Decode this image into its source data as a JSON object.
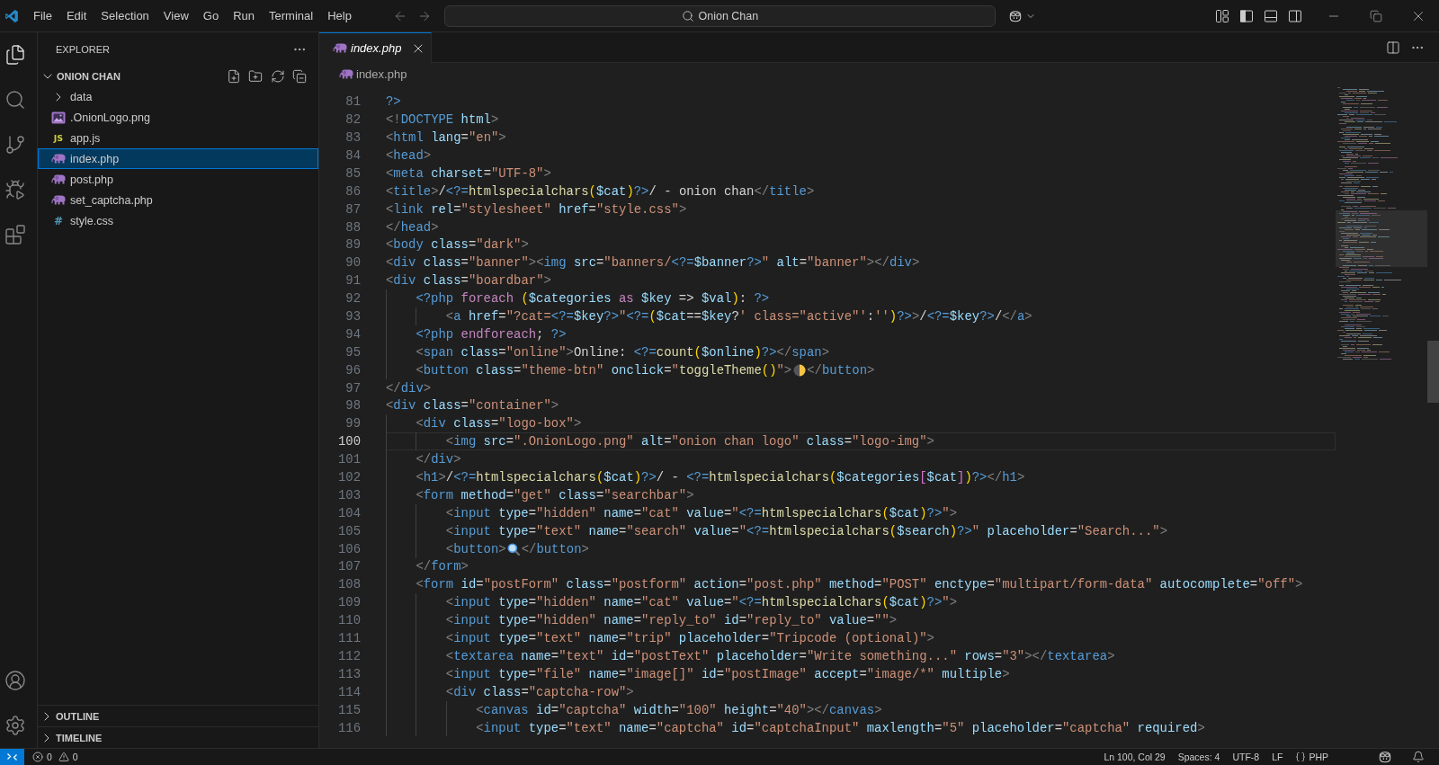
{
  "title_bar": {
    "menus": [
      "File",
      "Edit",
      "Selection",
      "View",
      "Go",
      "Run",
      "Terminal",
      "Help"
    ],
    "command_center": "Onion Chan",
    "layout_toggles": [
      {
        "kind": "primary_sidebar",
        "on": true
      },
      {
        "kind": "panel",
        "on": false
      },
      {
        "kind": "secondary_sidebar",
        "on": false
      }
    ]
  },
  "activity_bar": {
    "top": [
      {
        "kind": "explorer",
        "selected": true
      },
      {
        "kind": "search",
        "selected": false
      },
      {
        "kind": "source_control",
        "selected": false
      },
      {
        "kind": "run_debug",
        "selected": false
      },
      {
        "kind": "extensions",
        "selected": false
      }
    ],
    "bottom": [
      {
        "kind": "accounts"
      },
      {
        "kind": "settings"
      }
    ]
  },
  "sidebar": {
    "title": "EXPLORER",
    "root": {
      "label": "ONION CHAN",
      "expanded": true,
      "children": [
        {
          "kind": "folder",
          "label": "data",
          "expanded": false,
          "selected": false
        },
        {
          "kind": "image",
          "label": ".OnionLogo.png",
          "selected": false
        },
        {
          "kind": "js",
          "glyph": "JS",
          "label": "app.js",
          "selected": false
        },
        {
          "kind": "php",
          "label": "index.php",
          "selected": true
        },
        {
          "kind": "php",
          "label": "post.php",
          "selected": false
        },
        {
          "kind": "php",
          "label": "set_captcha.php",
          "selected": false
        },
        {
          "kind": "css",
          "glyph": "#",
          "label": "style.css",
          "selected": false
        }
      ]
    },
    "sections": [
      {
        "label": "OUTLINE",
        "expanded": false
      },
      {
        "label": "TIMELINE",
        "expanded": false
      }
    ]
  },
  "editor": {
    "tabs": [
      {
        "kind": "php",
        "label": "index.php",
        "selected": true,
        "preview": true
      }
    ],
    "breadcrumbs": [
      {
        "kind": "php",
        "label": "index.php"
      }
    ],
    "lines": [
      {
        "number": "81",
        "current": false,
        "tokens": [
          {
            "kind": "php",
            "text": "?>"
          }
        ]
      },
      {
        "number": "82",
        "current": false,
        "tokens": [
          {
            "kind": "punct",
            "text": "<!"
          },
          {
            "kind": "tag",
            "text": "DOCTYPE"
          },
          {
            "kind": "attr",
            "text": " html"
          },
          {
            "kind": "punct",
            "text": ">"
          }
        ]
      },
      {
        "number": "83",
        "current": false,
        "tokens": [
          {
            "kind": "punct",
            "text": "<"
          },
          {
            "kind": "tag",
            "text": "html"
          },
          {
            "kind": "attr",
            "text": " lang"
          },
          {
            "kind": "plain",
            "text": "="
          },
          {
            "kind": "string",
            "text": "\"en\""
          },
          {
            "kind": "punct",
            "text": ">"
          }
        ]
      },
      {
        "number": "84",
        "current": false,
        "tokens": [
          {
            "kind": "punct",
            "text": "<"
          },
          {
            "kind": "tag",
            "text": "head"
          },
          {
            "kind": "punct",
            "text": ">"
          }
        ]
      },
      {
        "number": "85",
        "current": false,
        "tokens": [
          {
            "kind": "punct",
            "text": "<"
          },
          {
            "kind": "tag",
            "text": "meta"
          },
          {
            "kind": "attr",
            "text": " charset"
          },
          {
            "kind": "plain",
            "text": "="
          },
          {
            "kind": "string",
            "text": "\"UTF-8\""
          },
          {
            "kind": "punct",
            "text": ">"
          }
        ]
      },
      {
        "number": "86",
        "current": false,
        "tokens": [
          {
            "kind": "punct",
            "text": "<"
          },
          {
            "kind": "tag",
            "text": "title"
          },
          {
            "kind": "punct",
            "text": ">"
          },
          {
            "kind": "plain",
            "text": "/"
          },
          {
            "kind": "php",
            "text": "<?="
          },
          {
            "kind": "function",
            "text": "htmlspecialchars"
          },
          {
            "kind": "paren",
            "text": "("
          },
          {
            "kind": "variable",
            "text": "$cat"
          },
          {
            "kind": "paren",
            "text": ")"
          },
          {
            "kind": "php",
            "text": "?>"
          },
          {
            "kind": "plain",
            "text": "/ - onion chan"
          },
          {
            "kind": "punct",
            "text": "</"
          },
          {
            "kind": "tag",
            "text": "title"
          },
          {
            "kind": "punct",
            "text": ">"
          }
        ]
      },
      {
        "number": "87",
        "current": false,
        "tokens": [
          {
            "kind": "punct",
            "text": "<"
          },
          {
            "kind": "tag",
            "text": "link"
          },
          {
            "kind": "attr",
            "text": " rel"
          },
          {
            "kind": "plain",
            "text": "="
          },
          {
            "kind": "string",
            "text": "\"stylesheet\""
          },
          {
            "kind": "attr",
            "text": " href"
          },
          {
            "kind": "plain",
            "text": "="
          },
          {
            "kind": "string",
            "text": "\"style.css\""
          },
          {
            "kind": "punct",
            "text": ">"
          }
        ]
      },
      {
        "number": "88",
        "current": false,
        "tokens": [
          {
            "kind": "punct",
            "text": "</"
          },
          {
            "kind": "tag",
            "text": "head"
          },
          {
            "kind": "punct",
            "text": ">"
          }
        ]
      },
      {
        "number": "89",
        "current": false,
        "tokens": [
          {
            "kind": "punct",
            "text": "<"
          },
          {
            "kind": "tag",
            "text": "body"
          },
          {
            "kind": "attr",
            "text": " class"
          },
          {
            "kind": "plain",
            "text": "="
          },
          {
            "kind": "string",
            "text": "\"dark\""
          },
          {
            "kind": "punct",
            "text": ">"
          }
        ]
      },
      {
        "number": "90",
        "current": false,
        "tokens": [
          {
            "kind": "punct",
            "text": "<"
          },
          {
            "kind": "tag",
            "text": "div"
          },
          {
            "kind": "attr",
            "text": " class"
          },
          {
            "kind": "plain",
            "text": "="
          },
          {
            "kind": "string",
            "text": "\"banner\""
          },
          {
            "kind": "punct",
            "text": "><"
          },
          {
            "kind": "tag",
            "text": "img"
          },
          {
            "kind": "attr",
            "text": " src"
          },
          {
            "kind": "plain",
            "text": "="
          },
          {
            "kind": "string",
            "text": "\"banners/"
          },
          {
            "kind": "php",
            "text": "<?="
          },
          {
            "kind": "variable",
            "text": "$banner"
          },
          {
            "kind": "php",
            "text": "?>"
          },
          {
            "kind": "string",
            "text": "\""
          },
          {
            "kind": "attr",
            "text": " alt"
          },
          {
            "kind": "plain",
            "text": "="
          },
          {
            "kind": "string",
            "text": "\"banner\""
          },
          {
            "kind": "punct",
            "text": "></"
          },
          {
            "kind": "tag",
            "text": "div"
          },
          {
            "kind": "punct",
            "text": ">"
          }
        ]
      },
      {
        "number": "91",
        "current": false,
        "tokens": [
          {
            "kind": "punct",
            "text": "<"
          },
          {
            "kind": "tag",
            "text": "div"
          },
          {
            "kind": "attr",
            "text": " class"
          },
          {
            "kind": "plain",
            "text": "="
          },
          {
            "kind": "string",
            "text": "\"boardbar\""
          },
          {
            "kind": "punct",
            "text": ">"
          }
        ]
      },
      {
        "number": "92",
        "current": false,
        "tokens": [
          {
            "kind": "php",
            "text": "    <?php"
          },
          {
            "kind": "keyword",
            "text": " foreach"
          },
          {
            "kind": "paren",
            "text": " ("
          },
          {
            "kind": "variable",
            "text": "$categories"
          },
          {
            "kind": "keyword",
            "text": " as"
          },
          {
            "kind": "variable",
            "text": " $key"
          },
          {
            "kind": "plain",
            "text": " =>"
          },
          {
            "kind": "variable",
            "text": " $val"
          },
          {
            "kind": "paren",
            "text": ")"
          },
          {
            "kind": "plain",
            "text": ":"
          },
          {
            "kind": "php",
            "text": " ?>"
          }
        ]
      },
      {
        "number": "93",
        "current": false,
        "tokens": [
          {
            "kind": "punct",
            "text": "        <"
          },
          {
            "kind": "tag",
            "text": "a"
          },
          {
            "kind": "attr",
            "text": " href"
          },
          {
            "kind": "plain",
            "text": "="
          },
          {
            "kind": "string",
            "text": "\"?cat="
          },
          {
            "kind": "php",
            "text": "<?="
          },
          {
            "kind": "variable",
            "text": "$key"
          },
          {
            "kind": "php",
            "text": "?>"
          },
          {
            "kind": "string",
            "text": "\""
          },
          {
            "kind": "php",
            "text": "<?="
          },
          {
            "kind": "paren",
            "text": "("
          },
          {
            "kind": "variable",
            "text": "$cat"
          },
          {
            "kind": "plain",
            "text": "=="
          },
          {
            "kind": "variable",
            "text": "$key"
          },
          {
            "kind": "plain",
            "text": "?"
          },
          {
            "kind": "string",
            "text": "' class=\"active\"'"
          },
          {
            "kind": "plain",
            "text": ":"
          },
          {
            "kind": "string",
            "text": "''"
          },
          {
            "kind": "paren",
            "text": ")"
          },
          {
            "kind": "php",
            "text": "?>"
          },
          {
            "kind": "punct",
            "text": ">"
          },
          {
            "kind": "plain",
            "text": "/"
          },
          {
            "kind": "php",
            "text": "<?="
          },
          {
            "kind": "variable",
            "text": "$key"
          },
          {
            "kind": "php",
            "text": "?>"
          },
          {
            "kind": "plain",
            "text": "/"
          },
          {
            "kind": "punct",
            "text": "</"
          },
          {
            "kind": "tag",
            "text": "a"
          },
          {
            "kind": "punct",
            "text": ">"
          }
        ]
      },
      {
        "number": "94",
        "current": false,
        "tokens": [
          {
            "kind": "php",
            "text": "    <?php"
          },
          {
            "kind": "keyword",
            "text": " endforeach"
          },
          {
            "kind": "plain",
            "text": ";"
          },
          {
            "kind": "php",
            "text": " ?>"
          }
        ]
      },
      {
        "number": "95",
        "current": false,
        "tokens": [
          {
            "kind": "punct",
            "text": "    <"
          },
          {
            "kind": "tag",
            "text": "span"
          },
          {
            "kind": "attr",
            "text": " class"
          },
          {
            "kind": "plain",
            "text": "="
          },
          {
            "kind": "string",
            "text": "\"online\""
          },
          {
            "kind": "punct",
            "text": ">"
          },
          {
            "kind": "plain",
            "text": "Online: "
          },
          {
            "kind": "php",
            "text": "<?="
          },
          {
            "kind": "function",
            "text": "count"
          },
          {
            "kind": "paren",
            "text": "("
          },
          {
            "kind": "variable",
            "text": "$online"
          },
          {
            "kind": "paren",
            "text": ")"
          },
          {
            "kind": "php",
            "text": "?>"
          },
          {
            "kind": "punct",
            "text": "</"
          },
          {
            "kind": "tag",
            "text": "span"
          },
          {
            "kind": "punct",
            "text": ">"
          }
        ]
      },
      {
        "number": "96",
        "current": false,
        "tokens": [
          {
            "kind": "punct",
            "text": "    <"
          },
          {
            "kind": "tag",
            "text": "button"
          },
          {
            "kind": "attr",
            "text": " class"
          },
          {
            "kind": "plain",
            "text": "="
          },
          {
            "kind": "string",
            "text": "\"theme-btn\""
          },
          {
            "kind": "attr",
            "text": " onclick"
          },
          {
            "kind": "plain",
            "text": "="
          },
          {
            "kind": "string",
            "text": "\""
          },
          {
            "kind": "function",
            "text": "toggleTheme"
          },
          {
            "kind": "paren",
            "text": "()"
          },
          {
            "kind": "string",
            "text": "\""
          },
          {
            "kind": "punct",
            "text": ">"
          },
          {
            "kind": "moon"
          },
          {
            "kind": "punct",
            "text": "</"
          },
          {
            "kind": "tag",
            "text": "button"
          },
          {
            "kind": "punct",
            "text": ">"
          }
        ]
      },
      {
        "number": "97",
        "current": false,
        "tokens": [
          {
            "kind": "punct",
            "text": "</"
          },
          {
            "kind": "tag",
            "text": "div"
          },
          {
            "kind": "punct",
            "text": ">"
          }
        ]
      },
      {
        "number": "98",
        "current": false,
        "tokens": [
          {
            "kind": "punct",
            "text": "<"
          },
          {
            "kind": "tag",
            "text": "div"
          },
          {
            "kind": "attr",
            "text": " class"
          },
          {
            "kind": "plain",
            "text": "="
          },
          {
            "kind": "string",
            "text": "\"container\""
          },
          {
            "kind": "punct",
            "text": ">"
          }
        ]
      },
      {
        "number": "99",
        "current": false,
        "tokens": [
          {
            "kind": "punct",
            "text": "    <"
          },
          {
            "kind": "tag",
            "text": "div"
          },
          {
            "kind": "attr",
            "text": " class"
          },
          {
            "kind": "plain",
            "text": "="
          },
          {
            "kind": "string",
            "text": "\"logo-box\""
          },
          {
            "kind": "punct",
            "text": ">"
          }
        ]
      },
      {
        "number": "100",
        "current": true,
        "tokens": [
          {
            "kind": "punct",
            "text": "        <"
          },
          {
            "kind": "tag",
            "text": "img"
          },
          {
            "kind": "attr",
            "text": " src"
          },
          {
            "kind": "plain",
            "text": "="
          },
          {
            "kind": "string",
            "text": "\".OnionLogo.png\""
          },
          {
            "kind": "attr",
            "text": " alt"
          },
          {
            "kind": "plain",
            "text": "="
          },
          {
            "kind": "string",
            "text": "\"onion chan logo\""
          },
          {
            "kind": "attr",
            "text": " class"
          },
          {
            "kind": "plain",
            "text": "="
          },
          {
            "kind": "string",
            "text": "\"logo-img\""
          },
          {
            "kind": "punct",
            "text": ">"
          }
        ]
      },
      {
        "number": "101",
        "current": false,
        "tokens": [
          {
            "kind": "punct",
            "text": "    </"
          },
          {
            "kind": "tag",
            "text": "div"
          },
          {
            "kind": "punct",
            "text": ">"
          }
        ]
      },
      {
        "number": "102",
        "current": false,
        "tokens": [
          {
            "kind": "punct",
            "text": "    <"
          },
          {
            "kind": "tag",
            "text": "h1"
          },
          {
            "kind": "punct",
            "text": ">"
          },
          {
            "kind": "plain",
            "text": "/"
          },
          {
            "kind": "php",
            "text": "<?="
          },
          {
            "kind": "function",
            "text": "htmlspecialchars"
          },
          {
            "kind": "paren",
            "text": "("
          },
          {
            "kind": "variable",
            "text": "$cat"
          },
          {
            "kind": "paren",
            "text": ")"
          },
          {
            "kind": "php",
            "text": "?>"
          },
          {
            "kind": "plain",
            "text": "/ - "
          },
          {
            "kind": "php",
            "text": "<?="
          },
          {
            "kind": "function",
            "text": "htmlspecialchars"
          },
          {
            "kind": "paren",
            "text": "("
          },
          {
            "kind": "variable",
            "text": "$categories"
          },
          {
            "kind": "bracket",
            "text": "["
          },
          {
            "kind": "variable",
            "text": "$cat"
          },
          {
            "kind": "bracket",
            "text": "]"
          },
          {
            "kind": "paren",
            "text": ")"
          },
          {
            "kind": "php",
            "text": "?>"
          },
          {
            "kind": "punct",
            "text": "</"
          },
          {
            "kind": "tag",
            "text": "h1"
          },
          {
            "kind": "punct",
            "text": ">"
          }
        ]
      },
      {
        "number": "103",
        "current": false,
        "tokens": [
          {
            "kind": "punct",
            "text": "    <"
          },
          {
            "kind": "tag",
            "text": "form"
          },
          {
            "kind": "attr",
            "text": " method"
          },
          {
            "kind": "plain",
            "text": "="
          },
          {
            "kind": "string",
            "text": "\"get\""
          },
          {
            "kind": "attr",
            "text": " class"
          },
          {
            "kind": "plain",
            "text": "="
          },
          {
            "kind": "string",
            "text": "\"searchbar\""
          },
          {
            "kind": "punct",
            "text": ">"
          }
        ]
      },
      {
        "number": "104",
        "current": false,
        "tokens": [
          {
            "kind": "punct",
            "text": "        <"
          },
          {
            "kind": "tag",
            "text": "input"
          },
          {
            "kind": "attr",
            "text": " type"
          },
          {
            "kind": "plain",
            "text": "="
          },
          {
            "kind": "string",
            "text": "\"hidden\""
          },
          {
            "kind": "attr",
            "text": " name"
          },
          {
            "kind": "plain",
            "text": "="
          },
          {
            "kind": "string",
            "text": "\"cat\""
          },
          {
            "kind": "attr",
            "text": " value"
          },
          {
            "kind": "plain",
            "text": "="
          },
          {
            "kind": "string",
            "text": "\""
          },
          {
            "kind": "php",
            "text": "<?="
          },
          {
            "kind": "function",
            "text": "htmlspecialchars"
          },
          {
            "kind": "paren",
            "text": "("
          },
          {
            "kind": "variable",
            "text": "$cat"
          },
          {
            "kind": "paren",
            "text": ")"
          },
          {
            "kind": "php",
            "text": "?>"
          },
          {
            "kind": "string",
            "text": "\""
          },
          {
            "kind": "punct",
            "text": ">"
          }
        ]
      },
      {
        "number": "105",
        "current": false,
        "tokens": [
          {
            "kind": "punct",
            "text": "        <"
          },
          {
            "kind": "tag",
            "text": "input"
          },
          {
            "kind": "attr",
            "text": " type"
          },
          {
            "kind": "plain",
            "text": "="
          },
          {
            "kind": "string",
            "text": "\"text\""
          },
          {
            "kind": "attr",
            "text": " name"
          },
          {
            "kind": "plain",
            "text": "="
          },
          {
            "kind": "string",
            "text": "\"search\""
          },
          {
            "kind": "attr",
            "text": " value"
          },
          {
            "kind": "plain",
            "text": "="
          },
          {
            "kind": "string",
            "text": "\""
          },
          {
            "kind": "php",
            "text": "<?="
          },
          {
            "kind": "function",
            "text": "htmlspecialchars"
          },
          {
            "kind": "paren",
            "text": "("
          },
          {
            "kind": "variable",
            "text": "$search"
          },
          {
            "kind": "paren",
            "text": ")"
          },
          {
            "kind": "php",
            "text": "?>"
          },
          {
            "kind": "string",
            "text": "\""
          },
          {
            "kind": "attr",
            "text": " placeholder"
          },
          {
            "kind": "plain",
            "text": "="
          },
          {
            "kind": "string",
            "text": "\"Search...\""
          },
          {
            "kind": "punct",
            "text": ">"
          }
        ]
      },
      {
        "number": "106",
        "current": false,
        "tokens": [
          {
            "kind": "punct",
            "text": "        <"
          },
          {
            "kind": "tag",
            "text": "button"
          },
          {
            "kind": "punct",
            "text": ">"
          },
          {
            "kind": "magnifier"
          },
          {
            "kind": "punct",
            "text": "</"
          },
          {
            "kind": "tag",
            "text": "button"
          },
          {
            "kind": "punct",
            "text": ">"
          }
        ]
      },
      {
        "number": "107",
        "current": false,
        "tokens": [
          {
            "kind": "punct",
            "text": "    </"
          },
          {
            "kind": "tag",
            "text": "form"
          },
          {
            "kind": "punct",
            "text": ">"
          }
        ]
      },
      {
        "number": "108",
        "current": false,
        "tokens": [
          {
            "kind": "punct",
            "text": "    <"
          },
          {
            "kind": "tag",
            "text": "form"
          },
          {
            "kind": "attr",
            "text": " id"
          },
          {
            "kind": "plain",
            "text": "="
          },
          {
            "kind": "string",
            "text": "\"postForm\""
          },
          {
            "kind": "attr",
            "text": " class"
          },
          {
            "kind": "plain",
            "text": "="
          },
          {
            "kind": "string",
            "text": "\"postform\""
          },
          {
            "kind": "attr",
            "text": " action"
          },
          {
            "kind": "plain",
            "text": "="
          },
          {
            "kind": "string",
            "text": "\"post.php\""
          },
          {
            "kind": "attr",
            "text": " method"
          },
          {
            "kind": "plain",
            "text": "="
          },
          {
            "kind": "string",
            "text": "\"POST\""
          },
          {
            "kind": "attr",
            "text": " enctype"
          },
          {
            "kind": "plain",
            "text": "="
          },
          {
            "kind": "string",
            "text": "\"multipart/form-data\""
          },
          {
            "kind": "attr",
            "text": " autocomplete"
          },
          {
            "kind": "plain",
            "text": "="
          },
          {
            "kind": "string",
            "text": "\"off\""
          },
          {
            "kind": "punct",
            "text": ">"
          }
        ]
      },
      {
        "number": "109",
        "current": false,
        "tokens": [
          {
            "kind": "punct",
            "text": "        <"
          },
          {
            "kind": "tag",
            "text": "input"
          },
          {
            "kind": "attr",
            "text": " type"
          },
          {
            "kind": "plain",
            "text": "="
          },
          {
            "kind": "string",
            "text": "\"hidden\""
          },
          {
            "kind": "attr",
            "text": " name"
          },
          {
            "kind": "plain",
            "text": "="
          },
          {
            "kind": "string",
            "text": "\"cat\""
          },
          {
            "kind": "attr",
            "text": " value"
          },
          {
            "kind": "plain",
            "text": "="
          },
          {
            "kind": "string",
            "text": "\""
          },
          {
            "kind": "php",
            "text": "<?="
          },
          {
            "kind": "function",
            "text": "htmlspecialchars"
          },
          {
            "kind": "paren",
            "text": "("
          },
          {
            "kind": "variable",
            "text": "$cat"
          },
          {
            "kind": "paren",
            "text": ")"
          },
          {
            "kind": "php",
            "text": "?>"
          },
          {
            "kind": "string",
            "text": "\""
          },
          {
            "kind": "punct",
            "text": ">"
          }
        ]
      },
      {
        "number": "110",
        "current": false,
        "tokens": [
          {
            "kind": "punct",
            "text": "        <"
          },
          {
            "kind": "tag",
            "text": "input"
          },
          {
            "kind": "attr",
            "text": " type"
          },
          {
            "kind": "plain",
            "text": "="
          },
          {
            "kind": "string",
            "text": "\"hidden\""
          },
          {
            "kind": "attr",
            "text": " name"
          },
          {
            "kind": "plain",
            "text": "="
          },
          {
            "kind": "string",
            "text": "\"reply_to\""
          },
          {
            "kind": "attr",
            "text": " id"
          },
          {
            "kind": "plain",
            "text": "="
          },
          {
            "kind": "string",
            "text": "\"reply_to\""
          },
          {
            "kind": "attr",
            "text": " value"
          },
          {
            "kind": "plain",
            "text": "="
          },
          {
            "kind": "string",
            "text": "\"\""
          },
          {
            "kind": "punct",
            "text": ">"
          }
        ]
      },
      {
        "number": "111",
        "current": false,
        "tokens": [
          {
            "kind": "punct",
            "text": "        <"
          },
          {
            "kind": "tag",
            "text": "input"
          },
          {
            "kind": "attr",
            "text": " type"
          },
          {
            "kind": "plain",
            "text": "="
          },
          {
            "kind": "string",
            "text": "\"text\""
          },
          {
            "kind": "attr",
            "text": " name"
          },
          {
            "kind": "plain",
            "text": "="
          },
          {
            "kind": "string",
            "text": "\"trip\""
          },
          {
            "kind": "attr",
            "text": " placeholder"
          },
          {
            "kind": "plain",
            "text": "="
          },
          {
            "kind": "string",
            "text": "\"Tripcode (optional)\""
          },
          {
            "kind": "punct",
            "text": ">"
          }
        ]
      },
      {
        "number": "112",
        "current": false,
        "tokens": [
          {
            "kind": "punct",
            "text": "        <"
          },
          {
            "kind": "tag",
            "text": "textarea"
          },
          {
            "kind": "attr",
            "text": " name"
          },
          {
            "kind": "plain",
            "text": "="
          },
          {
            "kind": "string",
            "text": "\"text\""
          },
          {
            "kind": "attr",
            "text": " id"
          },
          {
            "kind": "plain",
            "text": "="
          },
          {
            "kind": "string",
            "text": "\"postText\""
          },
          {
            "kind": "attr",
            "text": " placeholder"
          },
          {
            "kind": "plain",
            "text": "="
          },
          {
            "kind": "string",
            "text": "\"Write something...\""
          },
          {
            "kind": "attr",
            "text": " rows"
          },
          {
            "kind": "plain",
            "text": "="
          },
          {
            "kind": "string",
            "text": "\"3\""
          },
          {
            "kind": "punct",
            "text": "></"
          },
          {
            "kind": "tag",
            "text": "textarea"
          },
          {
            "kind": "punct",
            "text": ">"
          }
        ]
      },
      {
        "number": "113",
        "current": false,
        "tokens": [
          {
            "kind": "punct",
            "text": "        <"
          },
          {
            "kind": "tag",
            "text": "input"
          },
          {
            "kind": "attr",
            "text": " type"
          },
          {
            "kind": "plain",
            "text": "="
          },
          {
            "kind": "string",
            "text": "\"file\""
          },
          {
            "kind": "attr",
            "text": " name"
          },
          {
            "kind": "plain",
            "text": "="
          },
          {
            "kind": "string",
            "text": "\"image[]\""
          },
          {
            "kind": "attr",
            "text": " id"
          },
          {
            "kind": "plain",
            "text": "="
          },
          {
            "kind": "string",
            "text": "\"postImage\""
          },
          {
            "kind": "attr",
            "text": " accept"
          },
          {
            "kind": "plain",
            "text": "="
          },
          {
            "kind": "string",
            "text": "\"image/*\""
          },
          {
            "kind": "attr",
            "text": " multiple"
          },
          {
            "kind": "punct",
            "text": ">"
          }
        ]
      },
      {
        "number": "114",
        "current": false,
        "tokens": [
          {
            "kind": "punct",
            "text": "        <"
          },
          {
            "kind": "tag",
            "text": "div"
          },
          {
            "kind": "attr",
            "text": " class"
          },
          {
            "kind": "plain",
            "text": "="
          },
          {
            "kind": "string",
            "text": "\"captcha-row\""
          },
          {
            "kind": "punct",
            "text": ">"
          }
        ]
      },
      {
        "number": "115",
        "current": false,
        "tokens": [
          {
            "kind": "punct",
            "text": "            <"
          },
          {
            "kind": "tag",
            "text": "canvas"
          },
          {
            "kind": "attr",
            "text": " id"
          },
          {
            "kind": "plain",
            "text": "="
          },
          {
            "kind": "string",
            "text": "\"captcha\""
          },
          {
            "kind": "attr",
            "text": " width"
          },
          {
            "kind": "plain",
            "text": "="
          },
          {
            "kind": "string",
            "text": "\"100\""
          },
          {
            "kind": "attr",
            "text": " height"
          },
          {
            "kind": "plain",
            "text": "="
          },
          {
            "kind": "string",
            "text": "\"40\""
          },
          {
            "kind": "punct",
            "text": "></"
          },
          {
            "kind": "tag",
            "text": "canvas"
          },
          {
            "kind": "punct",
            "text": ">"
          }
        ]
      },
      {
        "number": "116",
        "current": false,
        "tokens": [
          {
            "kind": "punct",
            "text": "            <"
          },
          {
            "kind": "tag",
            "text": "input"
          },
          {
            "kind": "attr",
            "text": " type"
          },
          {
            "kind": "plain",
            "text": "="
          },
          {
            "kind": "string",
            "text": "\"text\""
          },
          {
            "kind": "attr",
            "text": " name"
          },
          {
            "kind": "plain",
            "text": "="
          },
          {
            "kind": "string",
            "text": "\"captcha\""
          },
          {
            "kind": "attr",
            "text": " id"
          },
          {
            "kind": "plain",
            "text": "="
          },
          {
            "kind": "string",
            "text": "\"captchaInput\""
          },
          {
            "kind": "attr",
            "text": " maxlength"
          },
          {
            "kind": "plain",
            "text": "="
          },
          {
            "kind": "string",
            "text": "\"5\""
          },
          {
            "kind": "attr",
            "text": " placeholder"
          },
          {
            "kind": "plain",
            "text": "="
          },
          {
            "kind": "string",
            "text": "\"captcha\""
          },
          {
            "kind": "attr",
            "text": " required"
          },
          {
            "kind": "punct",
            "text": ">"
          }
        ]
      }
    ]
  },
  "status_bar": {
    "errors": "0",
    "warnings": "0",
    "items": [
      {
        "kind": "text",
        "label": "Ln 100, Col 29"
      },
      {
        "kind": "text",
        "label": "Spaces: 4"
      },
      {
        "kind": "text",
        "label": "UTF-8"
      },
      {
        "kind": "text",
        "label": "LF"
      },
      {
        "kind": "language",
        "label": "PHP"
      }
    ]
  }
}
